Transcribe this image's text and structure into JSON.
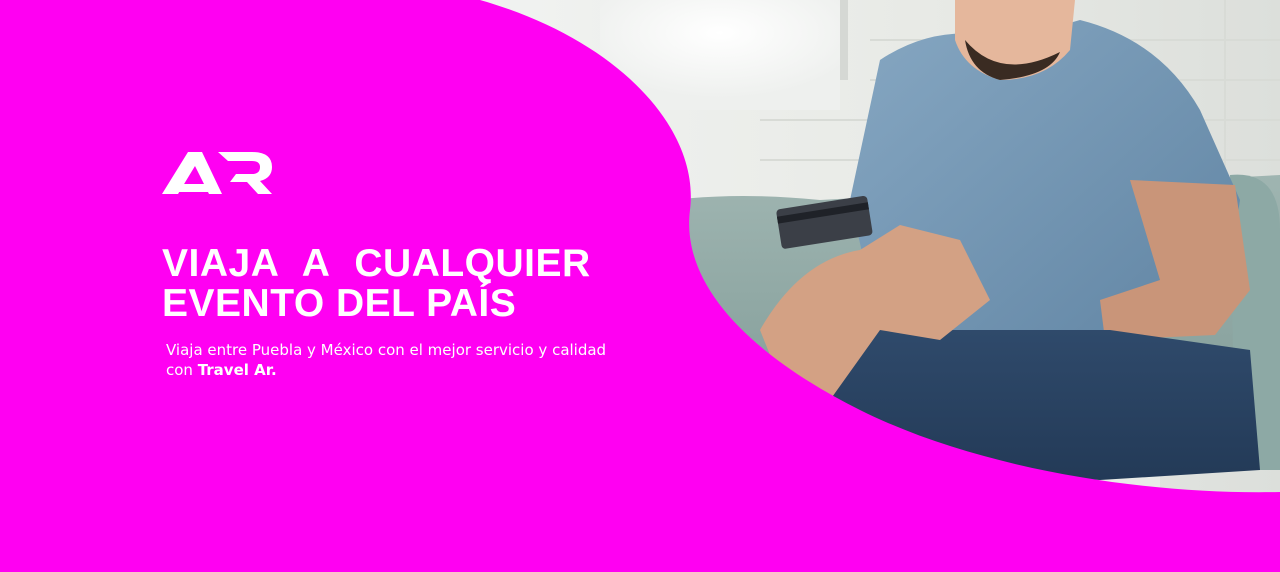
{
  "brand": {
    "logo_text": "AR",
    "name": "Travel Ar."
  },
  "hero": {
    "headline_line1": "VIAJA  A  CUALQUIER",
    "headline_line2": "EVENTO DEL PAÍS",
    "subtitle_text": "Viaja entre Puebla y México con el mejor servicio y calidad con ",
    "subtitle_brand": "Travel Ar."
  },
  "colors": {
    "primary": "#ff00f2",
    "text": "#ffffff"
  },
  "icons": {
    "logo": "ar-logo-icon"
  }
}
